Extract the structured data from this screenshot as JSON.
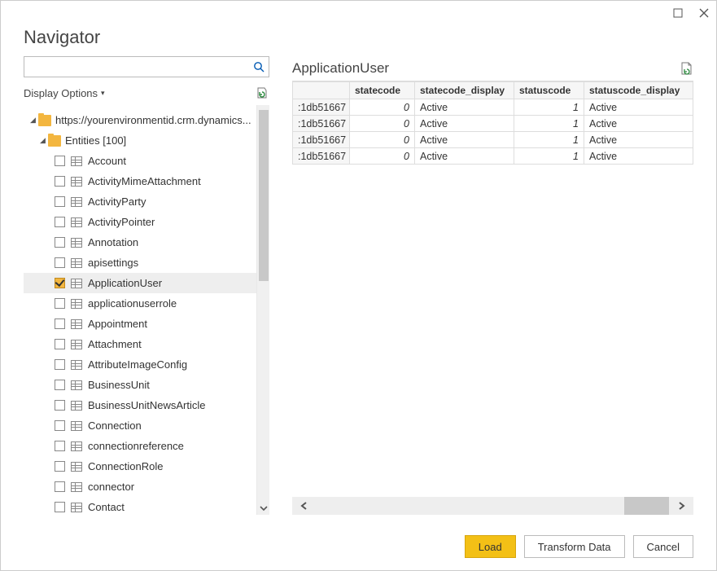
{
  "title": "Navigator",
  "search": {
    "placeholder": ""
  },
  "displayOptions": "Display Options",
  "tree": {
    "root": "https://yourenvironmentid.crm.dynamics...",
    "group": "Entities [100]",
    "items": [
      {
        "label": "Account",
        "checked": false
      },
      {
        "label": "ActivityMimeAttachment",
        "checked": false
      },
      {
        "label": "ActivityParty",
        "checked": false
      },
      {
        "label": "ActivityPointer",
        "checked": false
      },
      {
        "label": "Annotation",
        "checked": false
      },
      {
        "label": "apisettings",
        "checked": false
      },
      {
        "label": "ApplicationUser",
        "checked": true
      },
      {
        "label": "applicationuserrole",
        "checked": false
      },
      {
        "label": "Appointment",
        "checked": false
      },
      {
        "label": "Attachment",
        "checked": false
      },
      {
        "label": "AttributeImageConfig",
        "checked": false
      },
      {
        "label": "BusinessUnit",
        "checked": false
      },
      {
        "label": "BusinessUnitNewsArticle",
        "checked": false
      },
      {
        "label": "Connection",
        "checked": false
      },
      {
        "label": "connectionreference",
        "checked": false
      },
      {
        "label": "ConnectionRole",
        "checked": false
      },
      {
        "label": "connector",
        "checked": false
      },
      {
        "label": "Contact",
        "checked": false
      }
    ]
  },
  "preview": {
    "title": "ApplicationUser",
    "columns": [
      "statecode",
      "statecode_display",
      "statuscode",
      "statuscode_display"
    ],
    "rows": [
      {
        "id": ":1db51667",
        "statecode": "0",
        "statecode_display": "Active",
        "statuscode": "1",
        "statuscode_display": "Active"
      },
      {
        "id": ":1db51667",
        "statecode": "0",
        "statecode_display": "Active",
        "statuscode": "1",
        "statuscode_display": "Active"
      },
      {
        "id": ":1db51667",
        "statecode": "0",
        "statecode_display": "Active",
        "statuscode": "1",
        "statuscode_display": "Active"
      },
      {
        "id": ":1db51667",
        "statecode": "0",
        "statecode_display": "Active",
        "statuscode": "1",
        "statuscode_display": "Active"
      }
    ]
  },
  "buttons": {
    "load": "Load",
    "transform": "Transform Data",
    "cancel": "Cancel"
  }
}
